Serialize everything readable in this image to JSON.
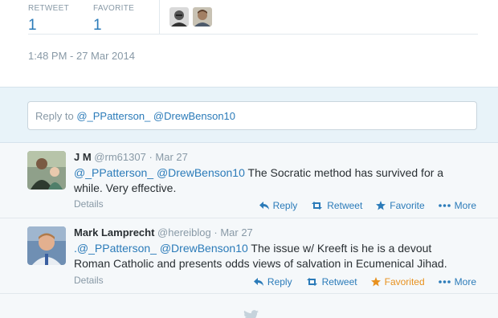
{
  "stats": {
    "retweet_label": "RETWEET",
    "retweet_count": "1",
    "favorite_label": "FAVORITE",
    "favorite_count": "1",
    "timestamp": "1:48 PM - 27 Mar 2014"
  },
  "reply": {
    "prefix": "Reply to ",
    "mention1": "@_PPatterson_",
    "mention2": "@DrewBenson10"
  },
  "tweets": [
    {
      "fullname": "J M",
      "handle": "@rm61307",
      "separator": "·",
      "time": "Mar 27",
      "text_lead": "",
      "mention1": "@_PPatterson_",
      "mention2": "@DrewBenson10",
      "text": "The Socratic method has survived for a while. Very effective.",
      "details": "Details",
      "actions": {
        "reply": "Reply",
        "retweet": "Retweet",
        "favorite": "Favorite",
        "more": "More"
      }
    },
    {
      "fullname": "Mark Lamprecht",
      "handle": "@hereiblog",
      "separator": "·",
      "time": "Mar 27",
      "text_lead": ".",
      "mention1": "@_PPatterson_",
      "mention2": "@DrewBenson10",
      "text": "The issue w/ Kreeft is he is a devout Roman Catholic and presents odds views of salvation in Ecumenical Jihad.",
      "details": "Details",
      "actions": {
        "reply": "Reply",
        "retweet": "Retweet",
        "favorite": "Favorited",
        "more": "More"
      }
    }
  ],
  "colors": {
    "link": "#2b7bb9",
    "muted": "#8899a6",
    "favorited": "#e8911e",
    "reply_bg": "#e8f3f9"
  },
  "icons": [
    "reply-icon",
    "retweet-icon",
    "star-icon",
    "more-dots-icon",
    "twitter-bird-icon"
  ]
}
